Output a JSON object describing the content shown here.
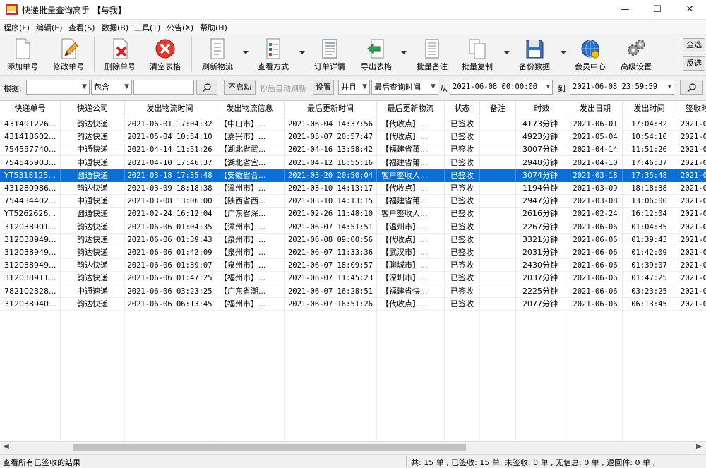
{
  "window": {
    "title": "快递批量查询高手 【与我】",
    "minimize": "—",
    "maximize": "☐",
    "close": "✕"
  },
  "menu": [
    "程序(F)",
    "编辑(E)",
    "查看(S)",
    "数据(B)",
    "工具(T)",
    "公告(X)",
    "帮助(H)"
  ],
  "toolbar": {
    "buttons": [
      {
        "label": "添加单号",
        "icon": "document-icon"
      },
      {
        "label": "修改单号",
        "icon": "pencil-document-icon"
      },
      {
        "label": "删除单号",
        "icon": "delete-document-icon"
      },
      {
        "label": "清空表格",
        "icon": "clear-red-x-icon"
      },
      {
        "label": "刷新物流",
        "icon": "refresh-document-icon"
      },
      {
        "label": "查看方式",
        "icon": "view-list-icon"
      },
      {
        "label": "订单详情",
        "icon": "order-detail-icon"
      },
      {
        "label": "导出表格",
        "icon": "export-arrow-icon"
      },
      {
        "label": "批量备注",
        "icon": "notes-icon"
      },
      {
        "label": "批量复制",
        "icon": "copy-icon"
      },
      {
        "label": "备份数据",
        "icon": "floppy-disk-icon"
      },
      {
        "label": "会员中心",
        "icon": "globe-member-icon"
      },
      {
        "label": "高级设置",
        "icon": "gears-icon"
      }
    ],
    "select_all": "全选",
    "invert": "反选"
  },
  "filter": {
    "basis_label": "根据:",
    "basis_value": "",
    "match_value": "包含",
    "search_value": "",
    "start_button": "不启动",
    "auto_refresh_text": "秒后自动刷新",
    "settings_button": "设置",
    "logic_value": "并且",
    "time_field": "最后查询时间",
    "from_label": "从",
    "from_value": "2021-06-08 00:00:00",
    "to_label": "到",
    "to_value": "2021-06-08 23:59:59"
  },
  "table": {
    "columns": [
      "快递单号",
      "快递公司",
      "发出物流时间",
      "发出物流信息",
      "最后更新时间",
      "最后更新物流",
      "状态",
      "备注",
      "时效",
      "发出日期",
      "发出时间",
      "签收时"
    ],
    "selected_index": 4,
    "rows": [
      [
        "431491226...",
        "韵达快递",
        "2021-06-01 17:04:32",
        "【中山市】...",
        "2021-06-04 14:37:56",
        "【代收点】...",
        "已签收",
        "",
        "4173分钟",
        "2021-06-01",
        "17:04:32",
        "2021-0"
      ],
      [
        "431418602...",
        "韵达快递",
        "2021-05-04 10:54:10",
        "【嘉兴市】...",
        "2021-05-07 20:57:47",
        "【代收点】...",
        "已签收",
        "",
        "4923分钟",
        "2021-05-04",
        "10:54:10",
        "2021-0"
      ],
      [
        "754557740...",
        "中通快递",
        "2021-04-14 11:51:26",
        "【湖北省武...",
        "2021-04-16 13:58:42",
        "【福建省莆...",
        "已签收",
        "",
        "3007分钟",
        "2021-04-14",
        "11:51:26",
        "2021-0"
      ],
      [
        "754545903...",
        "中通快递",
        "2021-04-10 17:46:37",
        "【湖北省宜...",
        "2021-04-12 18:55:16",
        "【福建省莆...",
        "已签收",
        "",
        "2948分钟",
        "2021-04-10",
        "17:46:37",
        "2021-0"
      ],
      [
        "YT5318125...",
        "圆通快递",
        "2021-03-18 17:35:48",
        "【安徽省合...",
        "2021-03-20 20:50:04",
        "客户签收人...",
        "已签收",
        "",
        "3074分钟",
        "2021-03-18",
        "17:35:48",
        "2021-0"
      ],
      [
        "431280986...",
        "韵达快递",
        "2021-03-09 18:18:38",
        "【漳州市】...",
        "2021-03-10 14:13:17",
        "【代收点】...",
        "已签收",
        "",
        "1194分钟",
        "2021-03-09",
        "18:18:38",
        "2021-0"
      ],
      [
        "754434402...",
        "中通快递",
        "2021-03-08 13:06:00",
        "【陕西省西...",
        "2021-03-10 14:13:15",
        "【福建省莆...",
        "已签收",
        "",
        "2947分钟",
        "2021-03-08",
        "13:06:00",
        "2021-0"
      ],
      [
        "YT5262626...",
        "圆通快递",
        "2021-02-24 16:12:04",
        "【广东省深...",
        "2021-02-26 11:48:10",
        "客户签收人...",
        "已签收",
        "",
        "2616分钟",
        "2021-02-24",
        "16:12:04",
        "2021-0"
      ],
      [
        "312038901...",
        "韵达快递",
        "2021-06-06 01:04:35",
        "【漳州市】...",
        "2021-06-07 14:51:51",
        "【温州市】...",
        "已签收",
        "",
        "2267分钟",
        "2021-06-06",
        "01:04:35",
        "2021-0"
      ],
      [
        "312038949...",
        "韵达快递",
        "2021-06-06 01:39:43",
        "【泉州市】...",
        "2021-06-08 09:00:56",
        "【代收点】...",
        "已签收",
        "",
        "3321分钟",
        "2021-06-06",
        "01:39:43",
        "2021-0"
      ],
      [
        "312038949...",
        "韵达快递",
        "2021-06-06 01:42:09",
        "【泉州市】...",
        "2021-06-07 11:33:36",
        "【武汉市】...",
        "已签收",
        "",
        "2031分钟",
        "2021-06-06",
        "01:42:09",
        "2021-0"
      ],
      [
        "312038949...",
        "韵达快递",
        "2021-06-06 01:39:07",
        "【泉州市】...",
        "2021-06-07 18:09:57",
        "【聊城市】...",
        "已签收",
        "",
        "2430分钟",
        "2021-06-06",
        "01:39:07",
        "2021-0"
      ],
      [
        "312038911...",
        "韵达快递",
        "2021-06-06 01:47:25",
        "【福州市】...",
        "2021-06-07 11:45:23",
        "【深圳市】...",
        "已签收",
        "",
        "2037分钟",
        "2021-06-06",
        "01:47:25",
        "2021-0"
      ],
      [
        "782102328...",
        "中通速递",
        "2021-06-06 03:23:25",
        "【广东省潮...",
        "2021-06-07 16:28:51",
        "【福建省快...",
        "已签收",
        "",
        "2225分钟",
        "2021-06-06",
        "03:23:25",
        "2021-0"
      ],
      [
        "312038940...",
        "韵达快递",
        "2021-06-06 06:13:45",
        "【福州市】...",
        "2021-06-07 16:51:26",
        "【代收点】...",
        "已签收",
        "",
        "2077分钟",
        "2021-06-06",
        "06:13:45",
        "2021-0"
      ]
    ]
  },
  "status": {
    "left": "查看所有已签收的结果",
    "right": "共: 15 单 , 已签收: 15 单, 未签收: 0 单 , 无信息: 0 单 , 退回件: 0 单 ,"
  }
}
